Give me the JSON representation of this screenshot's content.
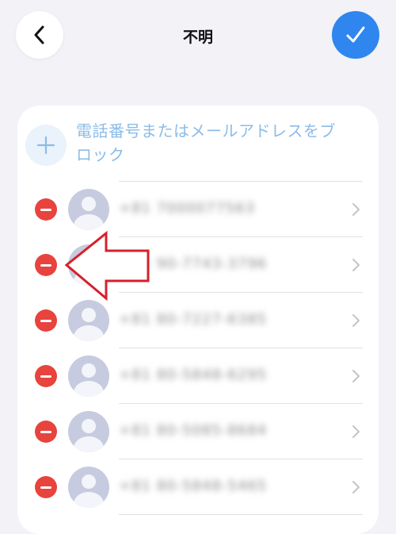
{
  "nav": {
    "title": "不明",
    "back_icon": "chevron-left-icon",
    "done_icon": "checkmark-icon",
    "accent_color": "#2f86ee"
  },
  "add_block": {
    "icon": "plus-icon",
    "label": "電話番号またはメールアドレスをブロック",
    "label_color": "#8cbce8"
  },
  "contacts": [
    {
      "number": "+81 7000077563",
      "redacted": true
    },
    {
      "number": "+81 90-7743-3796",
      "redacted": true
    },
    {
      "number": "+81 80-7227-6385",
      "redacted": true
    },
    {
      "number": "+81 80-5848-6295",
      "redacted": true
    },
    {
      "number": "+81 80-5085-8684",
      "redacted": true
    },
    {
      "number": "+81 80-5848-5465",
      "redacted": true
    }
  ],
  "annotation": {
    "type": "red-outline-arrow",
    "pointing_to": "delete-button of row 2",
    "color": "#d6202b"
  },
  "colors": {
    "background": "#f2f2f7",
    "delete": "#e8433d",
    "avatar": "#c7cbdf"
  }
}
